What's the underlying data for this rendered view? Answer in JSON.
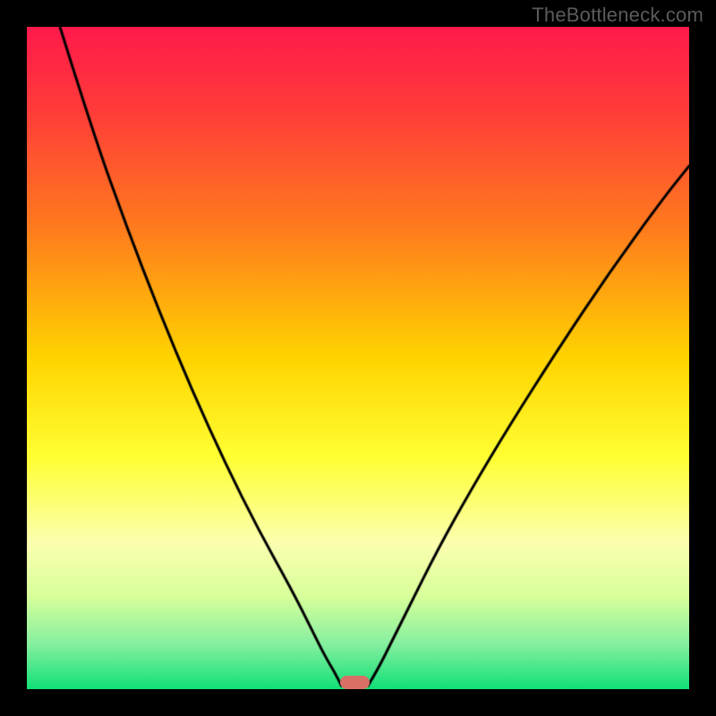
{
  "watermark": "TheBottleneck.com",
  "chart_data": {
    "type": "line",
    "title": "",
    "xlabel": "",
    "ylabel": "",
    "xlim": [
      0,
      100
    ],
    "ylim": [
      0,
      100
    ],
    "gradient_stops": [
      {
        "pos": 0.0,
        "color": "#ff1a4c"
      },
      {
        "pos": 0.12,
        "color": "#ff3a3a"
      },
      {
        "pos": 0.3,
        "color": "#ff7a1e"
      },
      {
        "pos": 0.5,
        "color": "#ffd400"
      },
      {
        "pos": 0.65,
        "color": "#ffff33"
      },
      {
        "pos": 0.78,
        "color": "#fbffb0"
      },
      {
        "pos": 0.86,
        "color": "#d8ff9a"
      },
      {
        "pos": 0.93,
        "color": "#88f0a0"
      },
      {
        "pos": 1.0,
        "color": "#12e077"
      }
    ],
    "series": [
      {
        "name": "left-branch",
        "x": [
          5,
          10,
          15,
          20,
          25,
          30,
          35,
          40,
          43,
          45,
          46.5,
          47.5
        ],
        "values": [
          100,
          84,
          70,
          57,
          45,
          34,
          24,
          15,
          9,
          5,
          2.5,
          0.5
        ]
      },
      {
        "name": "right-branch",
        "x": [
          51.5,
          53,
          55,
          58,
          62,
          67,
          73,
          80,
          88,
          96,
          100
        ],
        "values": [
          0.5,
          3,
          7,
          13,
          21,
          30,
          40,
          51,
          63,
          74,
          79
        ]
      }
    ],
    "marker": {
      "x_center": 49.5,
      "y": 0,
      "width": 4.5,
      "height": 2,
      "color": "#d97066"
    }
  }
}
